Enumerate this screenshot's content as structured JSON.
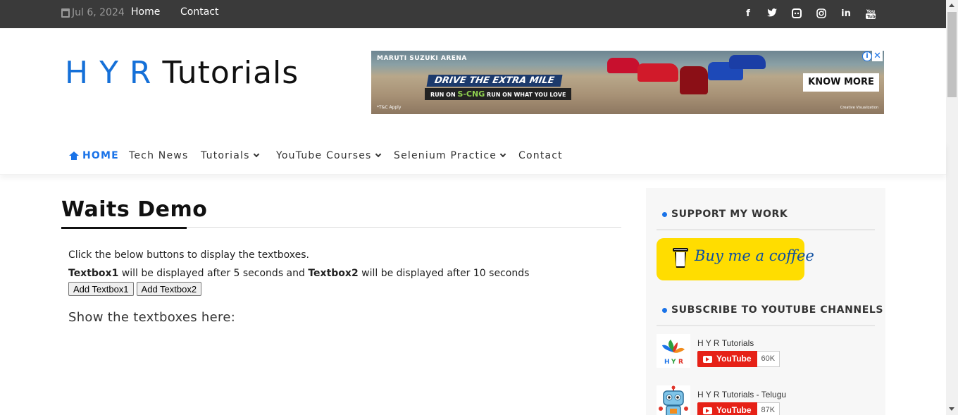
{
  "topbar": {
    "date": "Jul 6, 2024",
    "links": [
      {
        "label": "Home"
      },
      {
        "label": "Contact"
      }
    ],
    "social": [
      "facebook-icon",
      "twitter-icon",
      "discord-icon",
      "instagram-icon",
      "linkedin-icon",
      "youtube-icon"
    ]
  },
  "header": {
    "logo_part1": "H Y R",
    "logo_part2": "Tutorials"
  },
  "ad": {
    "brand": "MARUTI SUZUKI ARENA",
    "headline": "DRIVE THE EXTRA MILE",
    "tagline_prefix": "RUN ON",
    "tagline_brand": "S-CNG",
    "tagline_suffix": "RUN ON WHAT YOU LOVE",
    "cta": "KNOW MORE",
    "disclaimer": "*T&C Apply",
    "visualization": "Creative Visualization"
  },
  "nav": {
    "items": [
      {
        "label": "HOME"
      },
      {
        "label": "Tech News"
      },
      {
        "label": "Tutorials"
      },
      {
        "label": "YouTube Courses"
      },
      {
        "label": "Selenium Practice"
      },
      {
        "label": "Contact"
      }
    ]
  },
  "main": {
    "title": "Waits Demo",
    "intro": "Click the below buttons to display the textboxes.",
    "textbox1_label": "Textbox1",
    "textbox1_text": " will be displayed after 5 seconds and ",
    "textbox2_label": "Textbox2",
    "textbox2_text": " will be displayed after 10 seconds",
    "button1": "Add Textbox1",
    "button2": "Add Textbox2",
    "show_here": "Show the textboxes here:"
  },
  "sidebar": {
    "support_heading": "SUPPORT MY WORK",
    "coffee_label": "Buy me a coffee",
    "subscribe_heading": "SUBSCRIBE TO YOUTUBE CHANNELS",
    "channels": [
      {
        "name": "H Y R Tutorials",
        "button": "YouTube",
        "count": "60K"
      },
      {
        "name": "H Y R Tutorials - Telugu",
        "button": "YouTube",
        "count": "87K"
      }
    ]
  },
  "colors": {
    "accent": "#1a73e8",
    "topbar": "#3a3a3a",
    "coffee": "#ffdd00",
    "youtube": "#e62117"
  }
}
